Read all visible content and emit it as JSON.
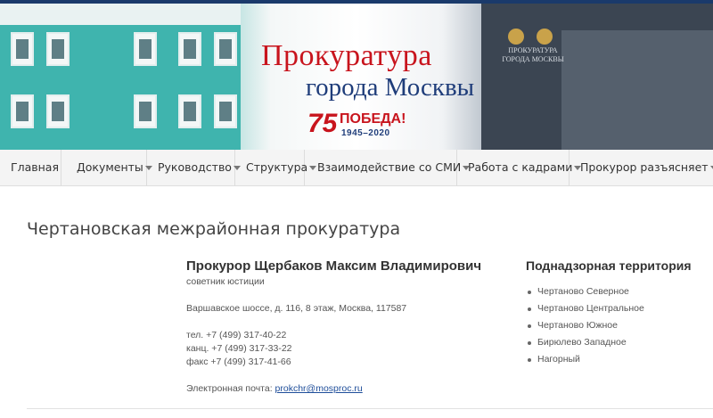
{
  "header": {
    "title_line1": "Прокуратура",
    "title_line2": "города Москвы",
    "victory_number": "75",
    "victory_text": "ПОБЕДА!",
    "victory_years": "1945–2020",
    "building_plaque": "ПРОКУРАТУРА ГОРОДА МОСКВЫ"
  },
  "nav": {
    "items": [
      {
        "label": "Главная",
        "has_dropdown": false
      },
      {
        "label": "Документы",
        "has_dropdown": true
      },
      {
        "label": "Руководство",
        "has_dropdown": true
      },
      {
        "label": "Структура",
        "has_dropdown": true
      },
      {
        "label": "Взаимодействие со СМИ",
        "has_dropdown": true
      },
      {
        "label": "Работа с кадрами",
        "has_dropdown": true
      },
      {
        "label": "Прокурор разъясняет",
        "has_dropdown": true
      }
    ]
  },
  "page": {
    "title": "Чертановская межрайонная прокуратура"
  },
  "info": {
    "prosecutor": "Прокурор Щербаков Максим Владимирович",
    "rank": "советник юстиции",
    "address": "Варшавское шоссе, д. 116, 8 этаж, Москва, 117587",
    "tel": "тел. +7 (499) 317-40-22",
    "kanc": "канц. +7 (499) 317-33-22",
    "fax": "факс +7 (499) 317-41-66",
    "email_label": "Электронная почта: ",
    "email": "prokchr@mosproc.ru"
  },
  "territory": {
    "heading": "Поднадзорная территория",
    "items": [
      "Чертаново Северное",
      "Чертаново Центральное",
      "Чертаново Южное",
      "Бирюлево Западное",
      "Нагорный"
    ]
  },
  "colors": {
    "title_red": "#c8141d",
    "title_blue": "#1f3d7a",
    "link": "#1f4e9a",
    "nav_bg": "#f4f4f4"
  }
}
